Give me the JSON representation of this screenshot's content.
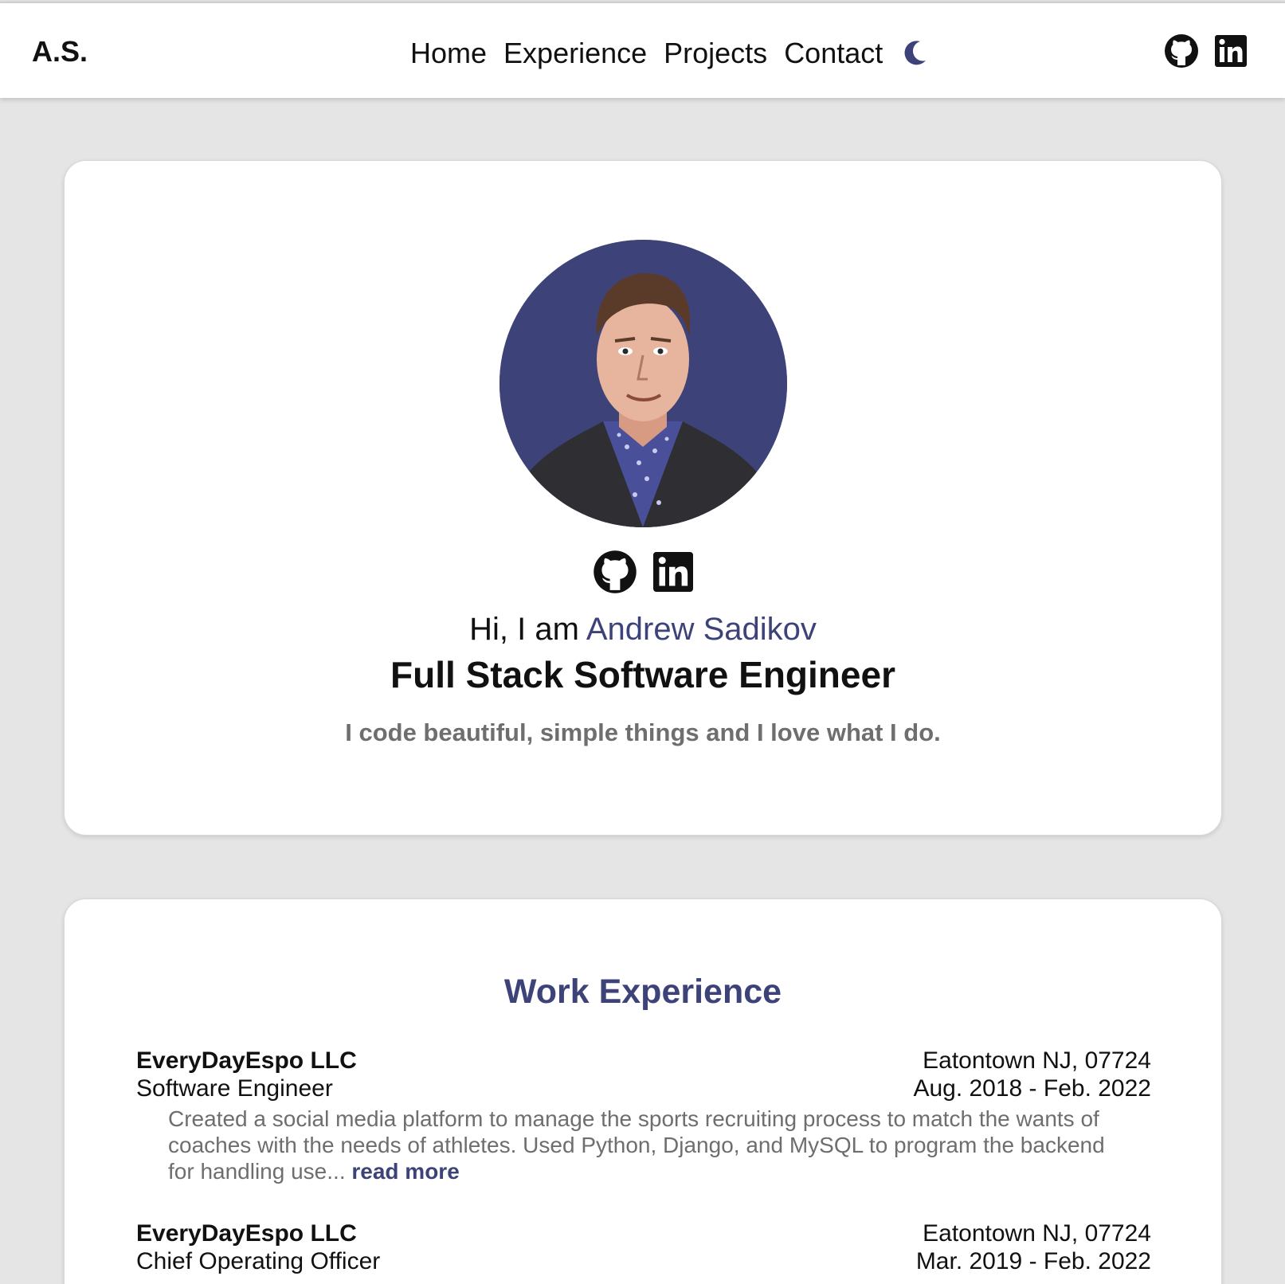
{
  "nav": {
    "brand": "A.S.",
    "links": [
      "Home",
      "Experience",
      "Projects",
      "Contact"
    ],
    "theme_toggle_icon": "moon-icon",
    "social_icons": [
      "github-icon",
      "linkedin-icon"
    ]
  },
  "hero": {
    "avatar_icon": "profile-photo",
    "greeting_prefix": "Hi, I am ",
    "name": "Andrew Sadikov",
    "role": "Full Stack Software Engineer",
    "tagline": "I code beautiful, simple things and I love what I do."
  },
  "experience": {
    "title": "Work Experience",
    "jobs": [
      {
        "company": "EveryDayEspo LLC",
        "location": "Eatontown NJ, 07724",
        "title": "Software Engineer",
        "dates": "Aug. 2018 - Feb. 2022",
        "description": "Created a social media platform to manage the sports recruiting process to match the wants of coaches with the needs of athletes. Used Python, Django, and MySQL to program the backend for handling use...",
        "read_more": "read more"
      },
      {
        "company": "EveryDayEspo LLC",
        "location": "Eatontown NJ, 07724",
        "title": "Chief Operating Officer",
        "dates": "Mar. 2019 - Feb. 2022"
      }
    ]
  },
  "colors": {
    "accent": "#3d4379",
    "background": "#e5e5e5",
    "card": "#ffffff",
    "muted_text": "#6e6e6e"
  }
}
